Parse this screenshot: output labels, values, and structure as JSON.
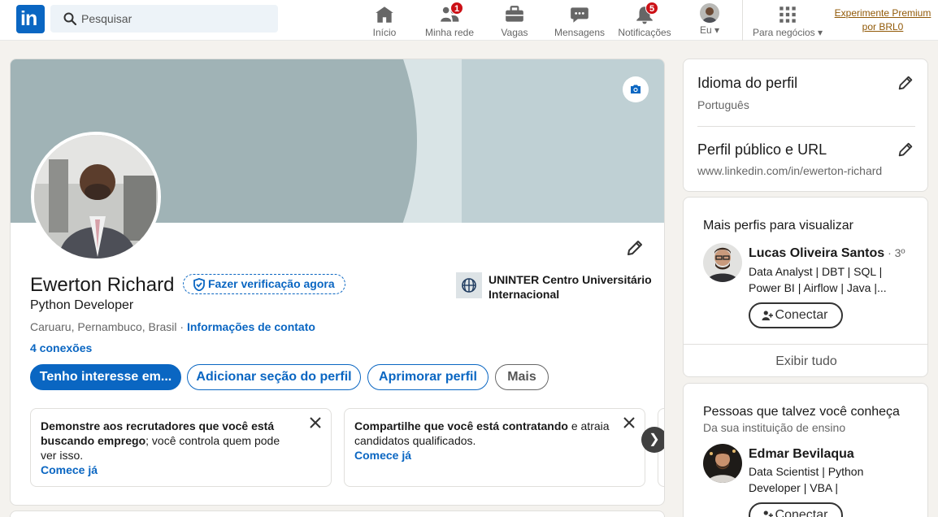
{
  "nav": {
    "search_placeholder": "Pesquisar",
    "items": [
      {
        "label": "Início",
        "icon": "home-icon"
      },
      {
        "label": "Minha rede",
        "icon": "network-icon",
        "badge": "1"
      },
      {
        "label": "Vagas",
        "icon": "jobs-icon"
      },
      {
        "label": "Mensagens",
        "icon": "messaging-icon"
      },
      {
        "label": "Notificações",
        "icon": "bell-icon",
        "badge": "5"
      },
      {
        "label": "Eu",
        "icon": "avatar"
      }
    ],
    "business_label": "Para negócios",
    "premium_label": "Experimente Premium por BRL0",
    "brand_color": "#0a66c2"
  },
  "profile": {
    "name": "Ewerton Richard",
    "verify_label": "Fazer verificação agora",
    "headline": "Python Developer",
    "location": "Caruaru, Pernambuco, Brasil",
    "location_sep": " · ",
    "contact_link": "Informações de contato",
    "connections": "4 conexões",
    "school": "UNINTER Centro Universitário Internacional",
    "buttons": {
      "open_to": "Tenho interesse em...",
      "add_section": "Adicionar seção do perfil",
      "enhance": "Aprimorar perfil",
      "more": "Mais"
    },
    "suggestions": [
      {
        "bold": "Demonstre aos recrutadores que você está buscando emprego",
        "rest": "; você controla quem pode ver isso.",
        "cta": "Comece já"
      },
      {
        "bold": "Compartilhe que você está contratando",
        "rest": " e atraia candidatos qualificados.",
        "cta": "Comece já"
      }
    ],
    "next_arrow": "❯"
  },
  "sidebar": {
    "language_title": "Idioma do perfil",
    "language_value": "Português",
    "public_title": "Perfil público e URL",
    "public_url": "www.linkedin.com/in/ewerton-richard",
    "more_profiles_title": "Mais perfis para visualizar",
    "more_profiles": [
      {
        "name": "Lucas Oliveira Santos",
        "degree": " · 3º",
        "desc": "Data Analyst | DBT | SQL | Power BI | Airflow | Java |...",
        "connect": "Conectar"
      }
    ],
    "show_all": "Exibir tudo",
    "people_title": "Pessoas que talvez você conheça",
    "people_subtitle": "Da sua instituição de ensino",
    "people": [
      {
        "name": "Edmar Bevilaqua",
        "desc": "Data Scientist | Python Developer | VBA |",
        "connect": "Conectar"
      }
    ]
  }
}
